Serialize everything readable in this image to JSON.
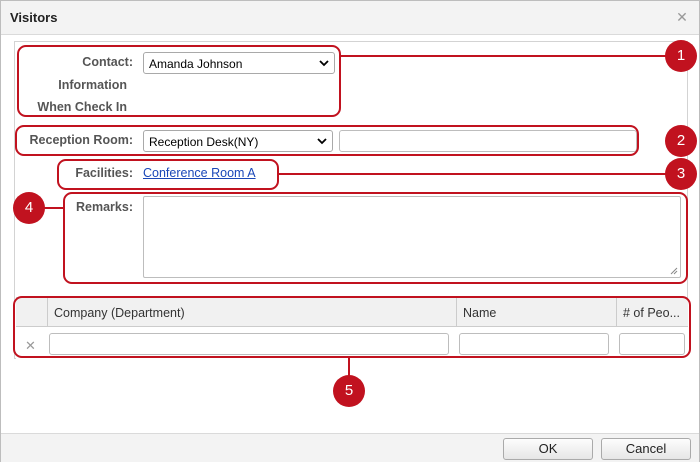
{
  "window": {
    "title": "Visitors"
  },
  "form": {
    "contact_label_1": "Contact:",
    "contact_label_2": "Information",
    "contact_label_3": "When Check In",
    "contact_value": "Amanda Johnson",
    "reception_label": "Reception Room:",
    "reception_value": "Reception Desk(NY)",
    "reception_extra_value": "",
    "facilities_label": "Facilities:",
    "facilities_link": "Conference Room A",
    "remarks_label": "Remarks:",
    "remarks_value": ""
  },
  "table": {
    "columns": [
      "Company (Department)",
      "Name",
      "# of Peo..."
    ],
    "rows": [
      {
        "company": "",
        "name": "",
        "people": ""
      }
    ]
  },
  "annotations": [
    "1",
    "2",
    "3",
    "4",
    "5"
  ],
  "footer": {
    "ok_label": "OK",
    "cancel_label": "Cancel"
  },
  "colors": {
    "annotation": "#c1121f",
    "link": "#1a47b8"
  }
}
